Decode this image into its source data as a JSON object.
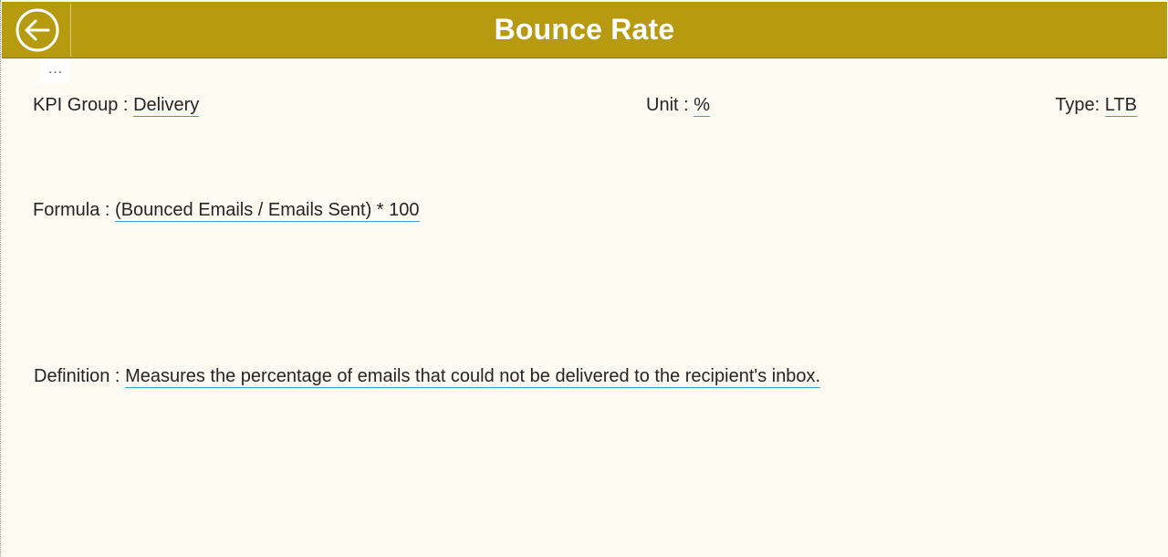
{
  "header": {
    "title": "Bounce Rate",
    "back_icon": "arrow-left-circle-icon",
    "background_color": "#b89a10",
    "title_color": "#ffffff"
  },
  "more_menu": {
    "label": "...",
    "icon": "more-options-icon"
  },
  "fields": {
    "kpi_group": {
      "label": "KPI Group :",
      "value": "Delivery"
    },
    "unit": {
      "label": "Unit :",
      "value": "%"
    },
    "type": {
      "label": "Type:",
      "value": "LTB"
    },
    "formula": {
      "label": "Formula :",
      "value": "(Bounced Emails / Emails Sent) * 100"
    },
    "definition": {
      "label": "Definition :",
      "value": "Measures the percentage of emails that could not be delivered to the recipient's inbox."
    }
  },
  "colors": {
    "page_background": "#fdfbf2",
    "value_underline": "#2fa7c0"
  }
}
